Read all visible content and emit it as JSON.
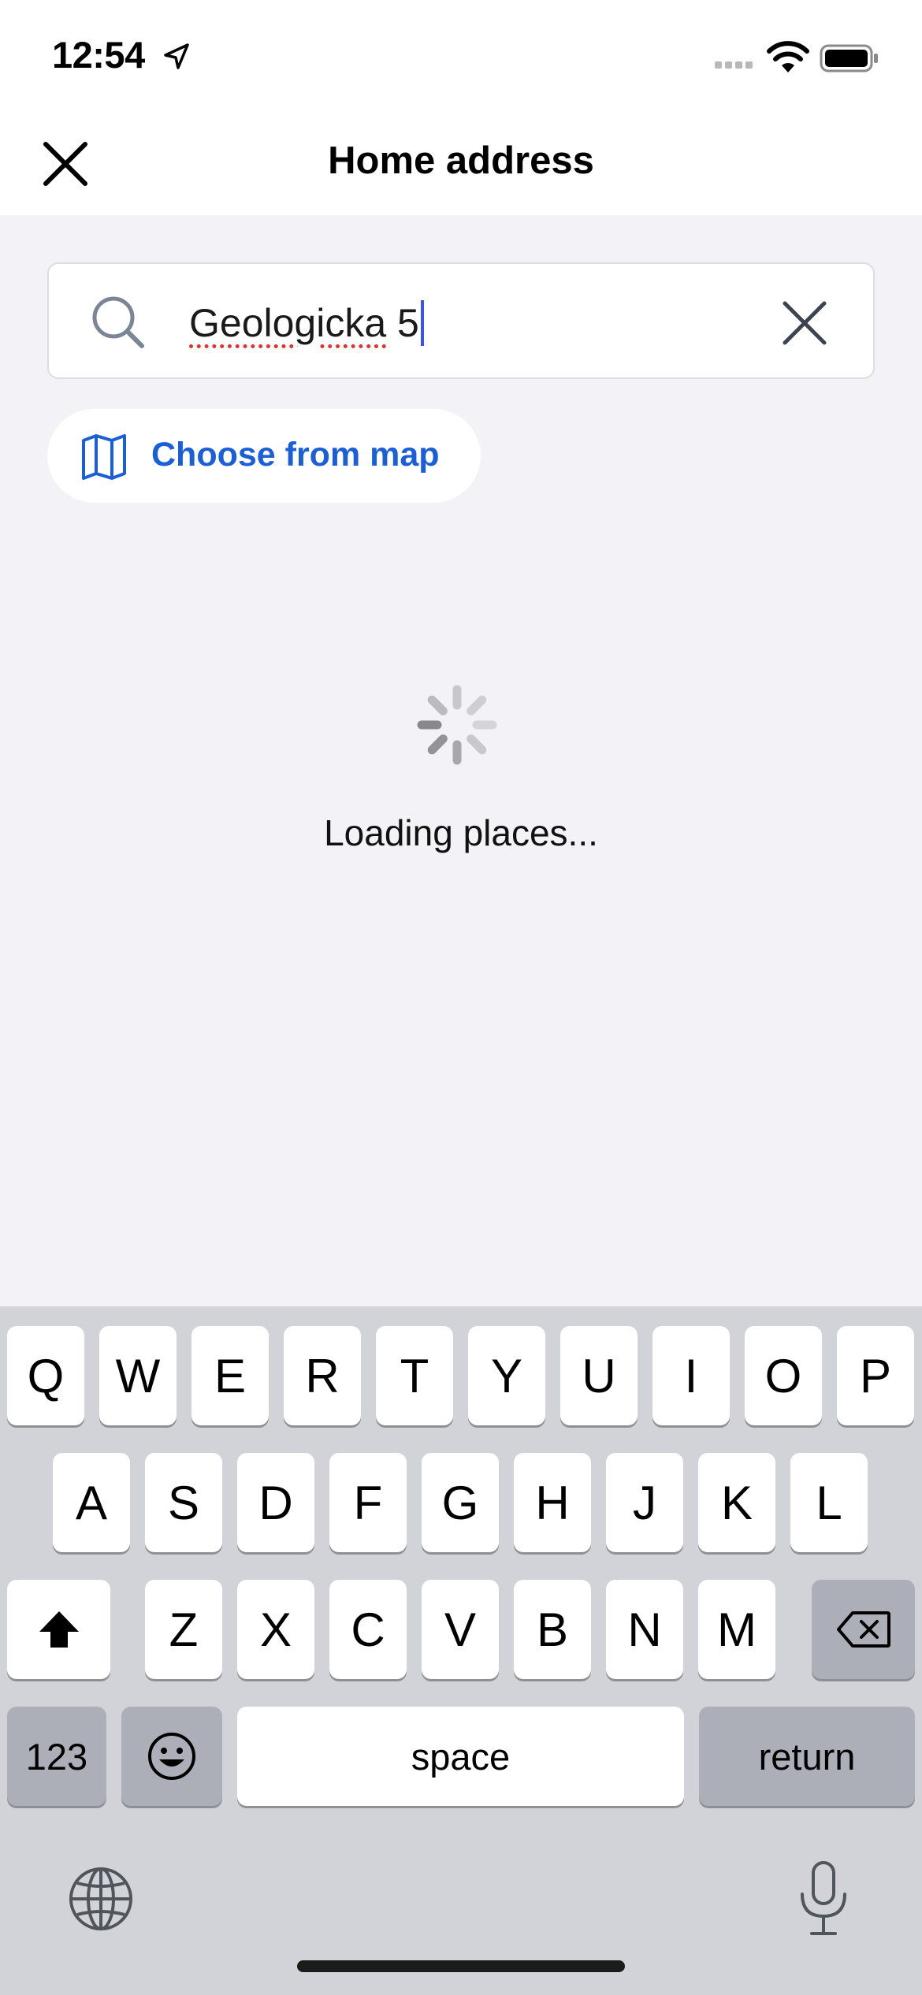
{
  "status_bar": {
    "time": "12:54",
    "icons": [
      "location-arrow-icon",
      "cellular-signal-icon",
      "wifi-icon",
      "battery-icon"
    ]
  },
  "header": {
    "title": "Home address",
    "close_icon": "close-icon"
  },
  "search": {
    "value_misspelled_part": "Geologicka",
    "value_rest": " 5",
    "icon": "search-icon",
    "clear_icon": "clear-icon"
  },
  "map_button": {
    "label": "Choose from map",
    "icon": "map-icon"
  },
  "loading": {
    "text": "Loading places..."
  },
  "keyboard": {
    "row1": [
      "Q",
      "W",
      "E",
      "R",
      "T",
      "Y",
      "U",
      "I",
      "O",
      "P"
    ],
    "row2": [
      "A",
      "S",
      "D",
      "F",
      "G",
      "H",
      "J",
      "K",
      "L"
    ],
    "row3": [
      "Z",
      "X",
      "C",
      "V",
      "B",
      "N",
      "M"
    ],
    "numbers_label": "123",
    "space_label": "space",
    "return_label": "return"
  },
  "colors": {
    "accent": "#1a5fd8",
    "background": "#f2f2f7",
    "keyboard": "#d1d3d9"
  }
}
